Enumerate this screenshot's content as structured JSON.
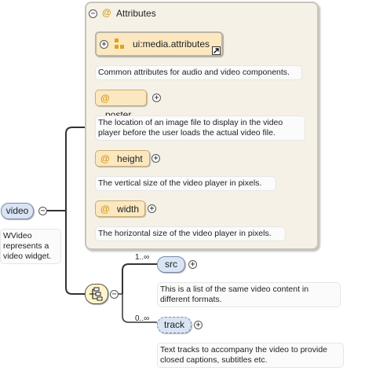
{
  "root": {
    "name": "video",
    "description": "WVideo represents a video widget."
  },
  "attributes_group": {
    "title": "Attributes",
    "reference": {
      "name": "ui:media.attributes",
      "description": "Common attributes for audio and video components."
    },
    "attributes": [
      {
        "name": "poster",
        "description": "The location of an image file to display in the video player before the user loads the actual video file."
      },
      {
        "name": "height",
        "description": "The vertical size of the video player in pixels."
      },
      {
        "name": "width",
        "description": "The horizontal size of the video player in pixels."
      }
    ]
  },
  "sequence": {
    "children": [
      {
        "name": "src",
        "cardinality": "1..∞",
        "description": "This is a list of the same video content in different formats."
      },
      {
        "name": "track",
        "cardinality": "0..∞",
        "description": "Text tracks to accompany the video to provide closed captions, subtitles etc."
      }
    ]
  },
  "symbols": {
    "attribute_marker": "@",
    "collapse": "−",
    "expand": "+",
    "colors": {
      "element_fill": "#d9e4f5",
      "attribute_fill": "#fbe8c0",
      "group_fill": "#f6f1e6",
      "attribute_marker": "#d89a1c"
    }
  }
}
